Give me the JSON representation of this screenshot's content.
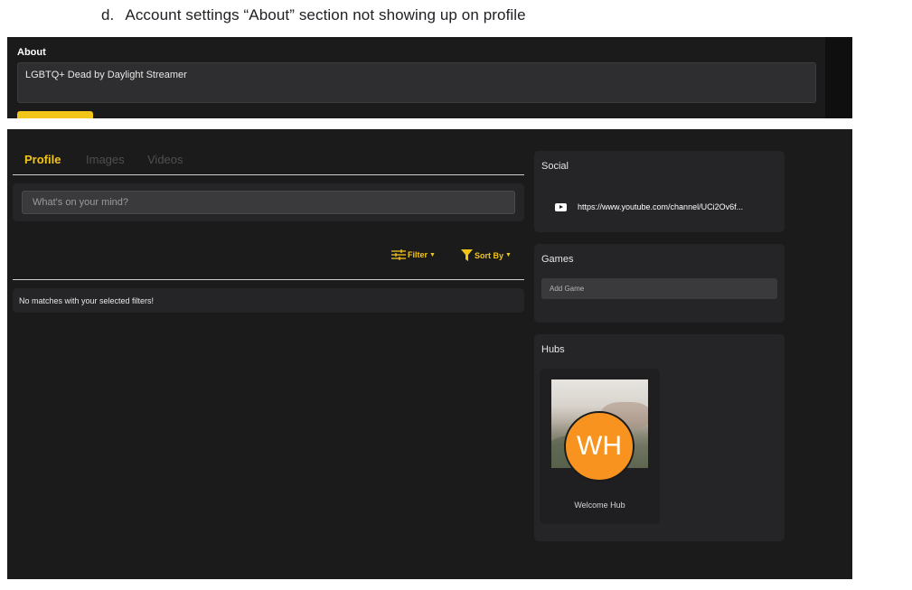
{
  "caption": {
    "number": "d.",
    "text": "Account settings “About” section not showing up on profile"
  },
  "about_settings": {
    "label": "About",
    "value": "LGBTQ+ Dead by Daylight Streamer"
  },
  "profile": {
    "tabs": [
      {
        "label": "Profile",
        "active": true
      },
      {
        "label": "Images",
        "active": false
      },
      {
        "label": "Videos",
        "active": false
      }
    ],
    "post_placeholder": "What's on your mind?",
    "filter_label": "Filter",
    "sort_label": "Sort By",
    "empty_message": "No matches with your selected filters!"
  },
  "sidebar": {
    "social": {
      "title": "Social",
      "link_icon": "youtube-icon",
      "link_text": "https://www.youtube.com/channel/UCi2Ov6f..."
    },
    "games": {
      "title": "Games",
      "add_placeholder": "Add Game"
    },
    "hubs": {
      "title": "Hubs",
      "items": [
        {
          "initials": "WH",
          "name": "Welcome Hub"
        }
      ]
    }
  },
  "colors": {
    "accent": "#f2c519",
    "background": "#1b1b1c",
    "card": "#252527",
    "hub_avatar": "#f7931e"
  }
}
